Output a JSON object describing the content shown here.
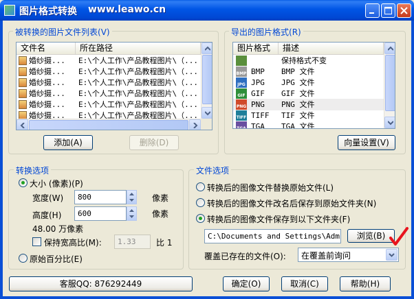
{
  "window": {
    "title": "图片格式转换",
    "url": "www.leawo.cn"
  },
  "source_group": {
    "label": "被转换的图片文件列表",
    "mnemonic": "(V)",
    "columns": [
      "文件名",
      "所在路径"
    ],
    "rows": [
      {
        "name": "婚纱摄...",
        "path": "E:\\个人工作\\产品教程图片\\（..."
      },
      {
        "name": "婚纱摄...",
        "path": "E:\\个人工作\\产品教程图片\\（..."
      },
      {
        "name": "婚纱摄...",
        "path": "E:\\个人工作\\产品教程图片\\（..."
      },
      {
        "name": "婚纱摄...",
        "path": "E:\\个人工作\\产品教程图片\\（..."
      },
      {
        "name": "婚纱摄...",
        "path": "E:\\个人工作\\产品教程图片\\（..."
      },
      {
        "name": "婚纱摄...",
        "path": "E:\\个人工作\\产品教程图片\\（..."
      },
      {
        "name": "婚纱摄...",
        "path": "E:\\个人工作\\产品教程图片\\（..."
      }
    ],
    "add_button": "添加(A)",
    "delete_button": "删除(D)"
  },
  "format_group": {
    "label": "导出的图片格式",
    "mnemonic": "(R)",
    "columns": [
      "图片格式",
      "描述"
    ],
    "rows": [
      {
        "icon": "keep-format-icon",
        "format": "",
        "desc": "保持格式不变",
        "color": "#5a8f3c",
        "badge": ""
      },
      {
        "icon": "bmp-icon",
        "format": "BMP",
        "desc": "BMP 文件",
        "color": "#9a9a9a",
        "badge": "BMP"
      },
      {
        "icon": "jpg-icon",
        "format": "JPG",
        "desc": "JPG 文件",
        "color": "#2e6fc0",
        "badge": "JPG"
      },
      {
        "icon": "gif-icon",
        "format": "GIF",
        "desc": "GIF 文件",
        "color": "#2f8f3a",
        "badge": "GIF"
      },
      {
        "icon": "png-icon",
        "format": "PNG",
        "desc": "PNG 文件",
        "color": "#d04a2a",
        "badge": "PNG"
      },
      {
        "icon": "tiff-icon",
        "format": "TIFF",
        "desc": "TIF 文件",
        "color": "#1f7f9a",
        "badge": "TIFF"
      },
      {
        "icon": "tga-icon",
        "format": "TGA",
        "desc": "TGA 文件",
        "color": "#6a4fa0",
        "badge": "TGA"
      }
    ],
    "selected_index": 4,
    "vector_button": "向量设置(V)"
  },
  "convert_group": {
    "label": "转换选项",
    "size_radio": "大小 (像素)(P)",
    "width_label": "宽度(W)",
    "width_value": "800",
    "height_label": "高度(H)",
    "height_value": "600",
    "unit_pixels": "像素",
    "megapixels": "48.00 万像素",
    "keep_ratio_label": "保持宽高比(M):",
    "ratio_value": "1.33",
    "ratio_suffix": "比 1",
    "percent_radio": "原始百分比(E)"
  },
  "file_group": {
    "label": "文件选项",
    "option1": "转换后的图像文件替换原始文件(L)",
    "option2": "转换后的图像文件改名后保存到原始文件夹(N)",
    "option3": "转换后的图像文件保存到以下文件夹(F)",
    "folder_path": "C:\\Documents and Settings\\Admini",
    "browse_button": "浏览(B)",
    "overwrite_label": "覆盖已存在的文件(O):",
    "overwrite_value": "在覆盖前询问"
  },
  "bottom": {
    "support_button": "客服QQ: 876292449",
    "ok_button": "确定(O)",
    "cancel_button": "取消(C)",
    "help_button": "帮助(H)"
  },
  "colors": {
    "accent": "#0046d5",
    "annotation": "#e8141e"
  }
}
